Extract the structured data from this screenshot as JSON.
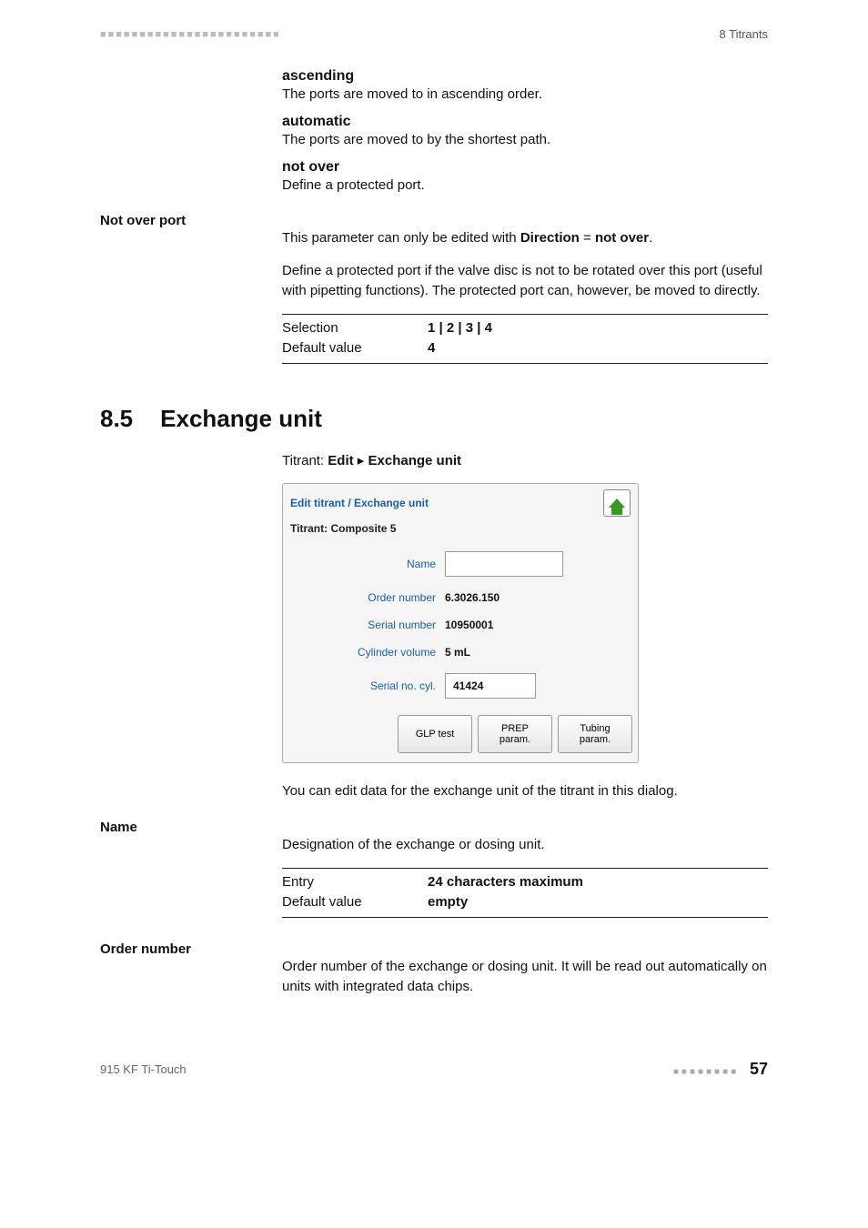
{
  "header": {
    "left_marks": "■■■■■■■■■■■■■■■■■■■■■■■",
    "right": "8 Titrants"
  },
  "dl": {
    "ascending": {
      "term": "ascending",
      "desc": "The ports are moved to in ascending order."
    },
    "automatic": {
      "term": "automatic",
      "desc": "The ports are moved to by the shortest path."
    },
    "not_over": {
      "term": "not over",
      "desc": "Define a protected port."
    }
  },
  "not_over_port": {
    "label": "Not over port",
    "line1_pre": "This parameter can only be edited with ",
    "line1_bold1": "Direction",
    "line1_mid": " = ",
    "line1_bold2": "not over",
    "line1_post": ".",
    "line2": "Define a protected port if the valve disc is not to be rotated over this port (useful with pipetting functions). The protected port can, however, be moved to directly.",
    "selection_k": "Selection",
    "selection_v": "1 | 2 | 3 | 4",
    "default_k": "Default value",
    "default_v": "4"
  },
  "section": {
    "num": "8.5",
    "title": "Exchange unit",
    "crumb_pre": "Titrant: ",
    "crumb_b1": "Edit",
    "crumb_sep": " ▸ ",
    "crumb_b2": "Exchange unit"
  },
  "dialog": {
    "title": "Edit titrant / Exchange unit",
    "sub": "Titrant: Composite 5",
    "rows": {
      "name": {
        "label": "Name",
        "value": ""
      },
      "order": {
        "label": "Order number",
        "value": "6.3026.150"
      },
      "serial": {
        "label": "Serial number",
        "value": "10950001"
      },
      "cyl": {
        "label": "Cylinder volume",
        "value": "5 mL"
      },
      "sncyl": {
        "label": "Serial no. cyl.",
        "value": "41424"
      }
    },
    "buttons": {
      "glp": "GLP test",
      "prep": "PREP\nparam.",
      "tub": "Tubing\nparam."
    }
  },
  "after_dialog": "You can edit data for the exchange unit of the titrant in this dialog.",
  "name_field": {
    "label": "Name",
    "desc": "Designation of the exchange or dosing unit.",
    "entry_k": "Entry",
    "entry_v": "24 characters maximum",
    "default_k": "Default value",
    "default_v": "empty"
  },
  "order_field": {
    "label": "Order number",
    "desc": "Order number of the exchange or dosing unit. It will be read out automatically on units with integrated data chips."
  },
  "footer": {
    "left": "915 KF Ti-Touch",
    "right_marks": "■■■■■■■■",
    "page": "57"
  }
}
